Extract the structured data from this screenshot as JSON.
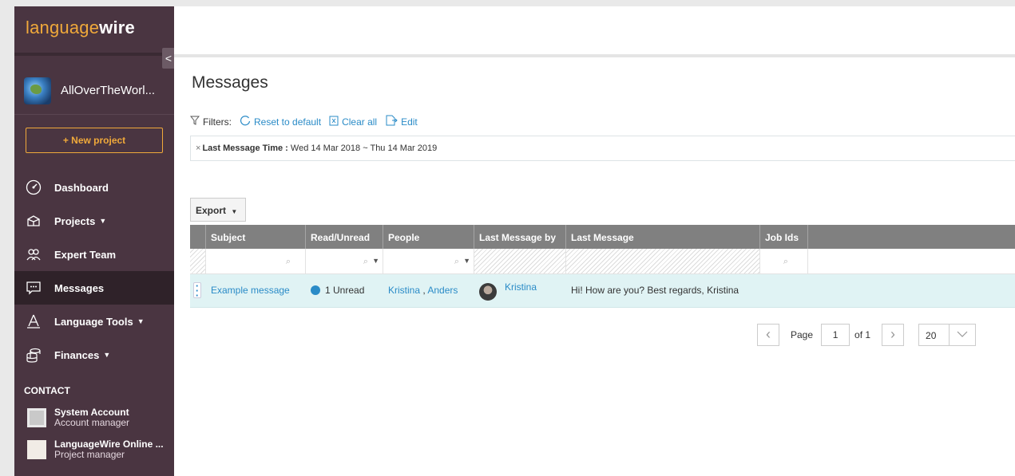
{
  "brand": {
    "logo_light": "language",
    "logo_bold": "wire"
  },
  "sidebar": {
    "collapse_icon": "<",
    "account_name": "AllOverTheWorl...",
    "new_project_label": "+ New project",
    "items": [
      {
        "label": "Dashboard",
        "icon": "speedometer-icon",
        "caret": false
      },
      {
        "label": "Projects",
        "icon": "box-icon",
        "caret": true
      },
      {
        "label": "Expert Team",
        "icon": "people-icon",
        "caret": false
      },
      {
        "label": "Messages",
        "icon": "chat-icon",
        "caret": false,
        "active": true
      },
      {
        "label": "Language Tools",
        "icon": "tools-icon",
        "caret": true
      },
      {
        "label": "Finances",
        "icon": "coins-icon",
        "caret": true
      }
    ],
    "contact_heading": "CONTACT",
    "contacts": [
      {
        "name": "System Account",
        "role": "Account manager"
      },
      {
        "name": "LanguageWire Online ...",
        "role": "Project manager"
      }
    ]
  },
  "page": {
    "title": "Messages"
  },
  "filters": {
    "label": "Filters:",
    "reset_label": "Reset to default",
    "clear_label": "Clear all",
    "edit_label": "Edit",
    "active_filter_remove": "×",
    "active_filter_name": "Last Message Time :",
    "active_filter_value": " Wed 14 Mar 2018 ~ Thu 14 Mar 2019"
  },
  "toolbar": {
    "export_label": "Export"
  },
  "table": {
    "columns": [
      "Subject",
      "Read/Unread",
      "People",
      "Last Message by",
      "Last Message",
      "Job Ids"
    ],
    "rows": [
      {
        "subject": "Example message",
        "status": "1 Unread",
        "people_1": "Kristina",
        "people_sep": " , ",
        "people_2": "Anders",
        "last_by": "Kristina",
        "last_message": "Hi! How are you? Best regards, Kristina",
        "job_ids": ""
      }
    ]
  },
  "pager": {
    "page_label": "Page",
    "page_value": "1",
    "of_label": "of 1",
    "page_size": "20"
  },
  "colors": {
    "accent": "#f0a93a",
    "link": "#2a8bc7",
    "sidebar": "#4a3541",
    "header": "#808080",
    "row_highlight": "#e0f3f4"
  }
}
